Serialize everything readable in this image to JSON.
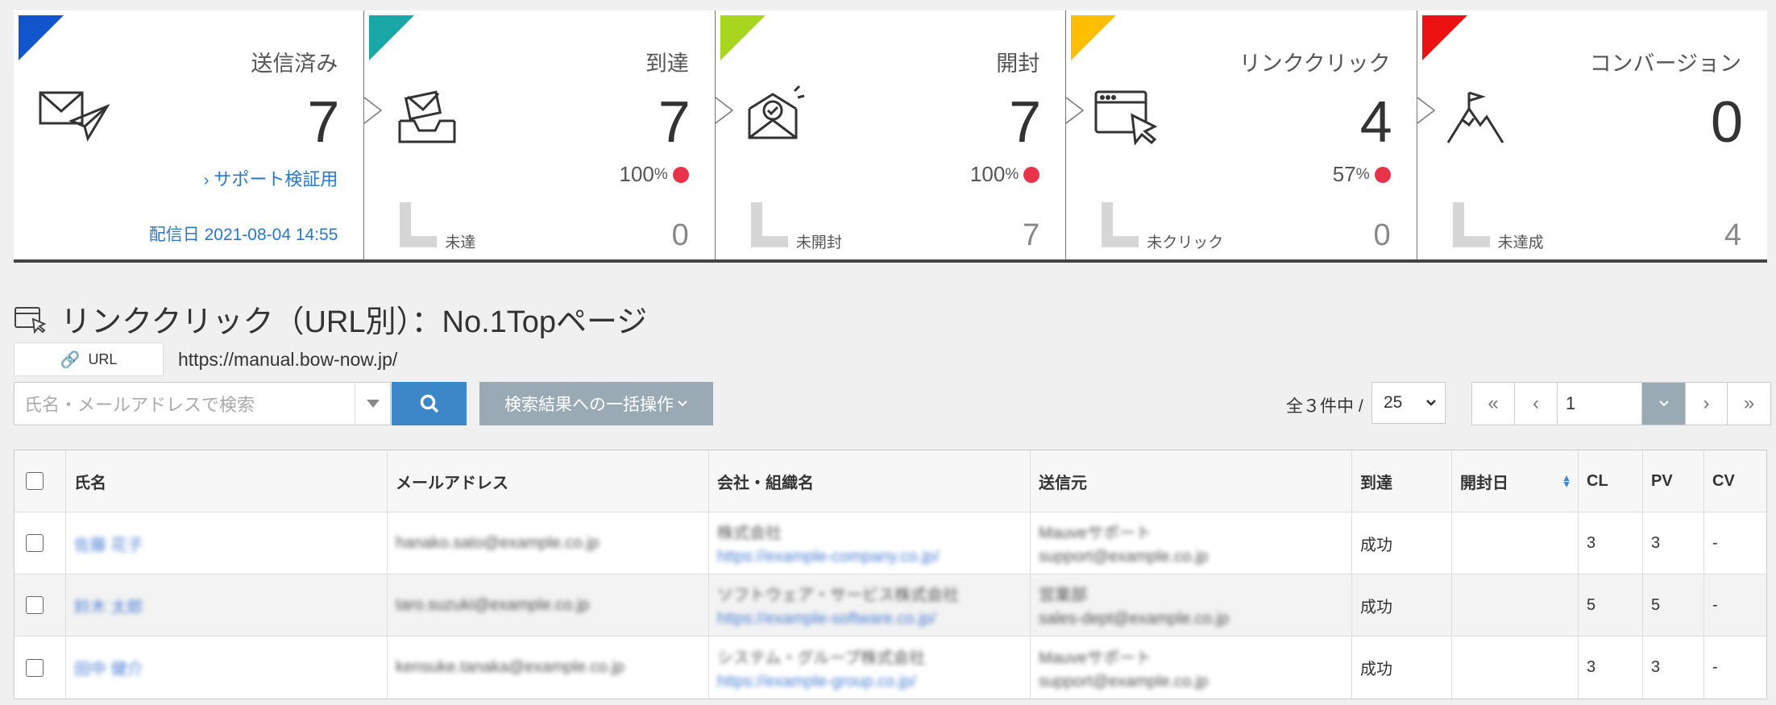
{
  "colors": {
    "sent": "#1155cc",
    "delivered": "#1aa7a7",
    "opened": "#a8d61e",
    "clicked": "#ffbf00",
    "conversion": "#ee1111",
    "accent_blue": "#3d87c8",
    "link_blue": "#2a78c8",
    "smile_red": "#e8334a",
    "bulk_gray": "#99aab5"
  },
  "cards": [
    {
      "title": "送信済み",
      "value": "7",
      "link": "サポート検証用",
      "date_label": "配信日",
      "date": "2021-08-04 14:55",
      "icon": "mail-send-icon"
    },
    {
      "title": "到達",
      "value": "7",
      "pct": "100",
      "pct_unit": "%",
      "sub_label": "未達",
      "sub_value": "0",
      "icon": "inbox-icon"
    },
    {
      "title": "開封",
      "value": "7",
      "pct": "100",
      "pct_unit": "%",
      "sub_label": "未開封",
      "sub_value": "7",
      "icon": "open-mail-icon"
    },
    {
      "title": "リンククリック",
      "value": "4",
      "pct": "57",
      "pct_unit": "%",
      "sub_label": "未クリック",
      "sub_value": "0",
      "icon": "browser-click-icon"
    },
    {
      "title": "コンバージョン",
      "value": "0",
      "sub_label": "未達成",
      "sub_value": "4",
      "icon": "mountain-flag-icon"
    }
  ],
  "section": {
    "title": "リンククリック（URL別）：No.1Topページ",
    "url_tag": "URL",
    "url": "https://manual.bow-now.jp/"
  },
  "toolbar": {
    "search_placeholder": "氏名・メールアドレスで検索",
    "bulk_label": "検索結果への一括操作",
    "total_text": "全３件中 /",
    "per_page": "25",
    "page_number": "1"
  },
  "table": {
    "headers": [
      "氏名",
      "メールアドレス",
      "会社・組織名",
      "送信元",
      "到達",
      "開封日",
      "CL",
      "PV",
      "CV"
    ],
    "rows": [
      {
        "name": "佐藤 花子",
        "email": "hanako.sato@example.co.jp",
        "company": "株式会社",
        "company_url": "https://example-company.co.jp/",
        "sender": "Mauveサポート",
        "sender_email": "support@example.co.jp",
        "delivered": "成功",
        "opened": "",
        "cl": "3",
        "pv": "3",
        "cv": "-"
      },
      {
        "name": "鈴木 太郎",
        "email": "taro.suzuki@example.co.jp",
        "company": "ソフトウェア・サービス株式会社",
        "company_url": "https://example-software.co.jp/",
        "sender": "営業部",
        "sender_email": "sales-dept@example.co.jp",
        "delivered": "成功",
        "opened": "",
        "cl": "5",
        "pv": "5",
        "cv": "-"
      },
      {
        "name": "田中 健介",
        "email": "kensuke.tanaka@example.co.jp",
        "company": "システム・グループ株式会社",
        "company_url": "https://example-group.co.jp/",
        "sender": "Mauveサポート",
        "sender_email": "support@example.co.jp",
        "delivered": "成功",
        "opened": "",
        "cl": "3",
        "pv": "3",
        "cv": "-"
      }
    ]
  }
}
